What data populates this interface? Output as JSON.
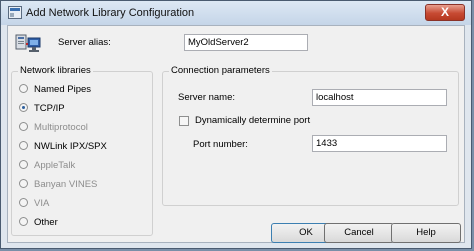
{
  "window": {
    "title": "Add Network Library Configuration",
    "close_glyph": "X"
  },
  "server_alias": {
    "label": "Server alias:",
    "value": "MyOldServer2"
  },
  "network_libraries": {
    "title": "Network libraries",
    "options": [
      {
        "label": "Named Pipes",
        "enabled": true,
        "selected": false
      },
      {
        "label": "TCP/IP",
        "enabled": true,
        "selected": true
      },
      {
        "label": "Multiprotocol",
        "enabled": false,
        "selected": false
      },
      {
        "label": "NWLink IPX/SPX",
        "enabled": true,
        "selected": false
      },
      {
        "label": "AppleTalk",
        "enabled": false,
        "selected": false
      },
      {
        "label": "Banyan VINES",
        "enabled": false,
        "selected": false
      },
      {
        "label": "VIA",
        "enabled": false,
        "selected": false
      },
      {
        "label": "Other",
        "enabled": true,
        "selected": false
      }
    ]
  },
  "connection_parameters": {
    "title": "Connection parameters",
    "server_name_label": "Server name:",
    "server_name_value": "localhost",
    "dynamic_port_label": "Dynamically determine port",
    "dynamic_port_checked": false,
    "port_label": "Port number:",
    "port_value": "1433"
  },
  "buttons": {
    "ok": "OK",
    "cancel": "Cancel",
    "help": "Help"
  }
}
